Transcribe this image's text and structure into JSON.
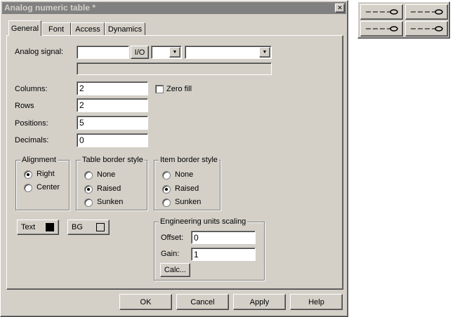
{
  "window": {
    "title": "Analog numeric table *",
    "close_glyph": "✕"
  },
  "tabs": [
    {
      "label": "General",
      "active": true
    },
    {
      "label": "Font"
    },
    {
      "label": "Access"
    },
    {
      "label": "Dynamics"
    }
  ],
  "signal": {
    "label": "Analog signal:",
    "value": "",
    "io_label": "I/O",
    "select1": "",
    "select2": "",
    "description": ""
  },
  "fields": {
    "columns": {
      "label": "Columns:",
      "value": "2"
    },
    "rows": {
      "label": "Rows",
      "value": "2"
    },
    "positions": {
      "label": "Positions:",
      "value": "5"
    },
    "decimals": {
      "label": "Decimals:",
      "value": "0"
    },
    "zero_fill": {
      "label": "Zero fill",
      "checked": false
    }
  },
  "alignment": {
    "title": "Alignment",
    "options": [
      "Right",
      "Center"
    ],
    "selected": "Right"
  },
  "table_border": {
    "title": "Table border style",
    "options": [
      "None",
      "Raised",
      "Sunken"
    ],
    "selected": "Raised"
  },
  "item_border": {
    "title": "Item border style",
    "options": [
      "None",
      "Raised",
      "Sunken"
    ],
    "selected": "Raised"
  },
  "colors": {
    "text_label": "Text",
    "text_color": "#000000",
    "bg_label": "BG",
    "bg_color": "#d4d0c8"
  },
  "scaling": {
    "title": "Engineering units scaling",
    "offset_label": "Offset:",
    "offset_value": "0",
    "gain_label": "Gain:",
    "gain_value": "1",
    "calc_label": "Calc..."
  },
  "buttons": {
    "ok": "OK",
    "cancel": "Cancel",
    "apply": "Apply",
    "help": "Help"
  },
  "theme": {
    "title_bar": "#808080",
    "face": "#d4d0c8"
  }
}
